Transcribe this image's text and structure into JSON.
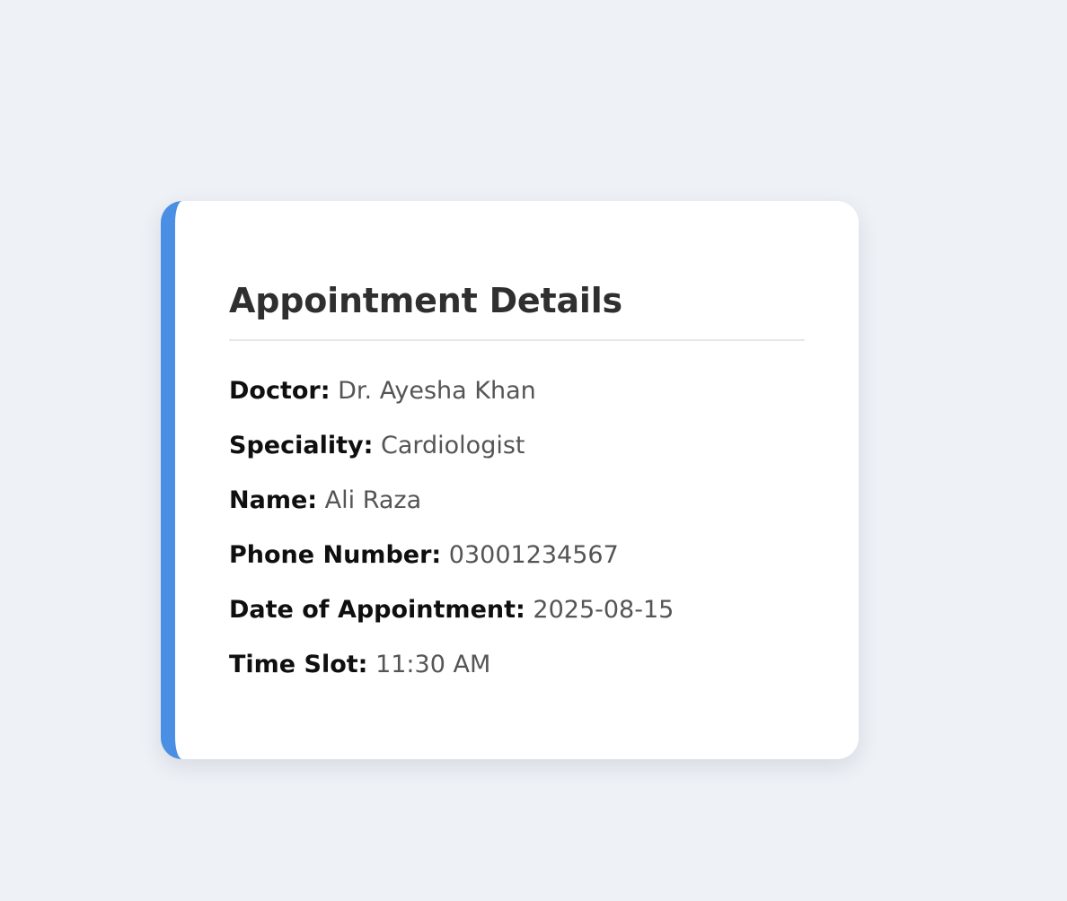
{
  "card": {
    "title": "Appointment Details",
    "accent_color": "#4a8fe3",
    "fields": [
      {
        "label": "Doctor:",
        "value": "Dr. Ayesha Khan"
      },
      {
        "label": "Speciality:",
        "value": "Cardiologist"
      },
      {
        "label": "Name:",
        "value": "Ali Raza"
      },
      {
        "label": "Phone Number:",
        "value": "03001234567"
      },
      {
        "label": "Date of Appointment:",
        "value": "2025-08-15"
      },
      {
        "label": "Time Slot:",
        "value": "11:30 AM"
      }
    ]
  }
}
